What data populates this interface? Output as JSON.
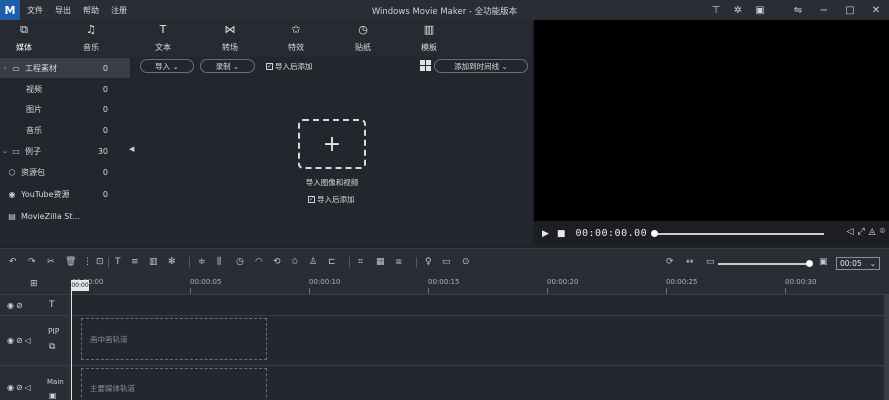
{
  "app": {
    "logo": "M",
    "title": "Windows Movie Maker  - 全功能版本",
    "menu": [
      "文件",
      "导出",
      "帮助",
      "注册"
    ]
  },
  "title_icons": [
    "pin-icon",
    "share-icon",
    "save-icon"
  ],
  "window_controls": [
    "restore-icon",
    "minimize-icon",
    "maximize-icon",
    "close-icon"
  ],
  "tabs": [
    {
      "icon": "⧉",
      "label": "媒体"
    },
    {
      "icon": "♫",
      "label": "音乐"
    },
    {
      "icon": "T",
      "label": "文本"
    },
    {
      "icon": "⋈",
      "label": "转场"
    },
    {
      "icon": "✩",
      "label": "特效"
    },
    {
      "icon": "◷",
      "label": "贴纸"
    },
    {
      "icon": "▥",
      "label": "模板"
    }
  ],
  "sidebar": {
    "items": [
      {
        "label": "工程素材",
        "count": "0",
        "caret": "›",
        "icon": "▭"
      },
      {
        "label": "视频",
        "count": "0"
      },
      {
        "label": "图片",
        "count": "0"
      },
      {
        "label": "音乐",
        "count": "0"
      },
      {
        "label": "例子",
        "count": "30",
        "caret": "⌄",
        "icon": "▭"
      },
      {
        "label": "资源包",
        "count": "0",
        "icon": "⬡"
      },
      {
        "label": "YouTube资源",
        "count": "0",
        "icon": "◉"
      },
      {
        "label": "MovieZilla St...",
        "count": "",
        "icon": "▤"
      }
    ]
  },
  "media_toolbar": {
    "import_label": "导入 ⌄",
    "record_label": "录制 ⌄",
    "add_after_import": "导入后添加",
    "add_to_timeline": "添加到时间线 ⌄"
  },
  "import_area": {
    "plus": "+",
    "label": "导入图像和视频",
    "add_after_import": "导入后添加"
  },
  "preview": {
    "timecode": "00:00:00.00",
    "progress": 0
  },
  "timeline_toolbar": {
    "zoom_value": "00:05",
    "zoom_level": 1.0
  },
  "timeline": {
    "ticks": [
      "00:00:00",
      "00:00:05",
      "00:00:10",
      "00:00:15",
      "00:00:20",
      "00:00:25",
      "00:00:30"
    ],
    "playhead_label": "00:00",
    "tracks": [
      {
        "label": "T",
        "kind": "text"
      },
      {
        "label": "PIP",
        "kind": "pip",
        "placeholder": "画中画轨道"
      },
      {
        "label": "Main",
        "kind": "main",
        "placeholder": "主要媒体轨道"
      }
    ]
  }
}
